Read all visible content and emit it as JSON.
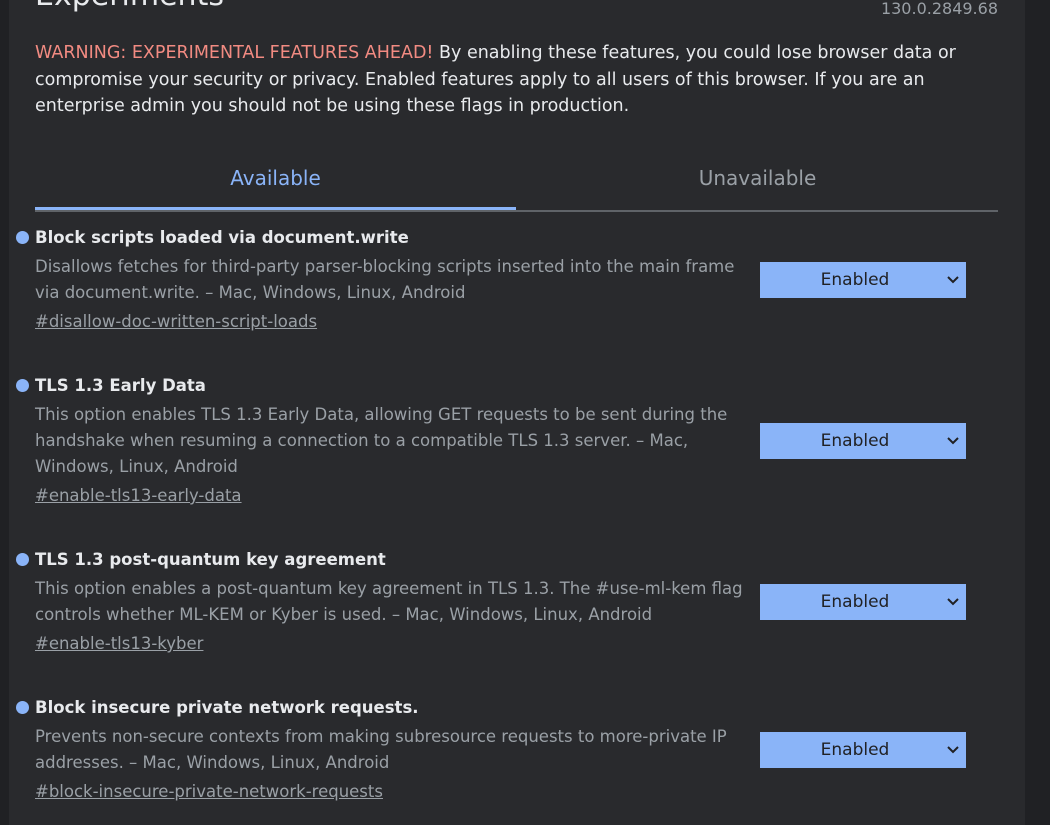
{
  "header": {
    "title": "Experiments",
    "version": "130.0.2849.68"
  },
  "warning": {
    "heading": "WARNING: EXPERIMENTAL FEATURES AHEAD!",
    "body": " By enabling these features, you could lose browser data or compromise your security or privacy. Enabled features apply to all users of this browser. If you are an enterprise admin you should not be using these flags in production."
  },
  "tabs": [
    {
      "label": "Available",
      "active": true
    },
    {
      "label": "Unavailable",
      "active": false
    }
  ],
  "flags": [
    {
      "name": "Block scripts loaded via document.write",
      "description": "Disallows fetches for third-party parser-blocking scripts inserted into the main frame via document.write. – Mac, Windows, Linux, Android",
      "link": "#disallow-doc-written-script-loads",
      "value": "Enabled"
    },
    {
      "name": "TLS 1.3 Early Data",
      "description": "This option enables TLS 1.3 Early Data, allowing GET requests to be sent during the handshake when resuming a connection to a compatible TLS 1.3 server. – Mac, Windows, Linux, Android",
      "link": "#enable-tls13-early-data",
      "value": "Enabled"
    },
    {
      "name": "TLS 1.3 post-quantum key agreement",
      "description": "This option enables a post-quantum key agreement in TLS 1.3. The #use-ml-kem flag controls whether ML-KEM or Kyber is used. – Mac, Windows, Linux, Android",
      "link": "#enable-tls13-kyber",
      "value": "Enabled"
    },
    {
      "name": "Block insecure private network requests.",
      "description": "Prevents non-secure contexts from making subresource requests to more-private IP addresses. – Mac, Windows, Linux, Android",
      "link": "#block-insecure-private-network-requests",
      "value": "Enabled"
    }
  ],
  "icons": {
    "dropdown": "chevron-down-icon",
    "bullet": "dot-icon"
  },
  "colors": {
    "background": "#292a2d",
    "accent": "#8ab4f8",
    "warning": "#f28b82",
    "text": "#e8eaed",
    "muted": "#9aa0a6"
  }
}
